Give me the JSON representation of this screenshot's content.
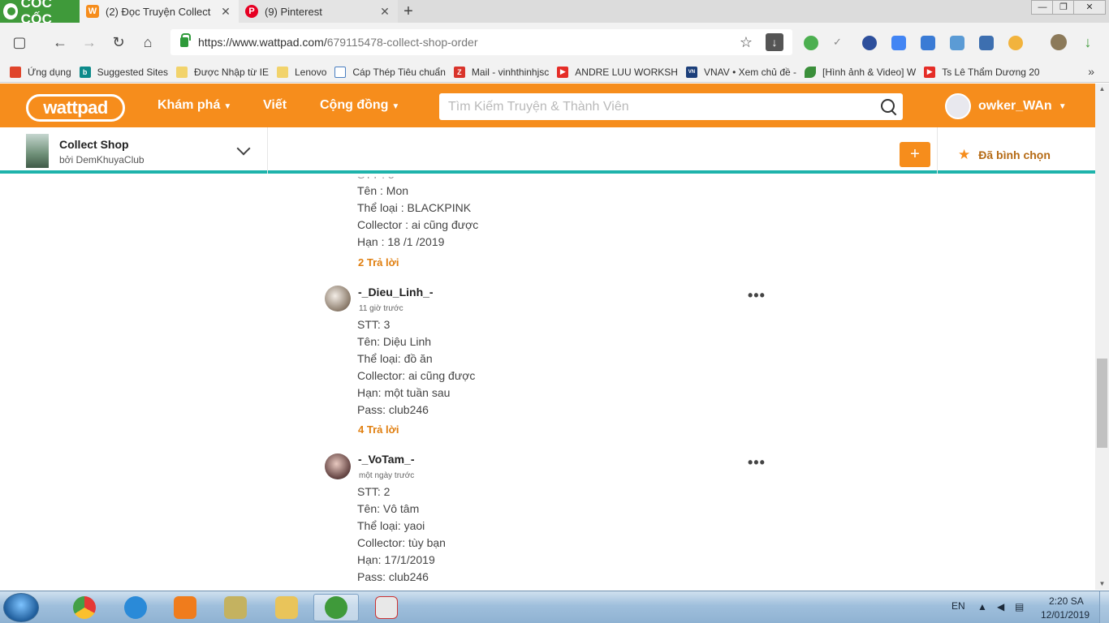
{
  "browser": {
    "logo": "CỐC CỐC",
    "tabs": [
      {
        "title": "(2) Đọc Truyện Collect",
        "close": "✕",
        "favicon": "wattpad-icon"
      },
      {
        "title": "(9) Pinterest",
        "close": "✕",
        "favicon": "pinterest-icon"
      }
    ],
    "new_tab": "+",
    "window_controls": [
      "—",
      "❐",
      "✕"
    ],
    "url_host": "https://www.wattpad.com/",
    "url_path": "679115478-collect-shop-order",
    "bookmarks": [
      {
        "label": "Ứng dụng",
        "icon": "apps-grid-icon",
        "color": "#e0452b"
      },
      {
        "label": "Suggested Sites",
        "icon": "bing-icon",
        "color": "#0d8a8a"
      },
      {
        "label": "Được Nhập từ IE",
        "icon": "folder-icon",
        "color": "#f2d36b"
      },
      {
        "label": "Lenovo",
        "icon": "folder-icon",
        "color": "#f2d36b"
      },
      {
        "label": "Cáp Thép Tiêu chuẩn",
        "icon": "page-icon",
        "color": "#4a7fc1"
      },
      {
        "label": "Mail - vinhthinhjsc",
        "icon": "zimbra-icon",
        "color": "#d9342b"
      },
      {
        "label": "ANDRE LUU WORKSH",
        "icon": "youtube-icon",
        "color": "#e52d27"
      },
      {
        "label": "VNAV • Xem chủ đề -",
        "icon": "vnav-icon",
        "color": "#1c3f7a"
      },
      {
        "label": "[Hình ảnh & Video] W",
        "icon": "leaf-icon",
        "color": "#3a8f3a"
      },
      {
        "label": "Ts Lê Thẩm Dương 20",
        "icon": "youtube-icon",
        "color": "#e52d27"
      }
    ],
    "bookmarks_more": "»"
  },
  "wattpad": {
    "logo": "wattpad",
    "nav": {
      "discover": "Khám phá",
      "write": "Viết",
      "community": "Cộng đồng"
    },
    "search_placeholder": "Tìm Kiếm Truyện & Thành Viên",
    "username": "owker_WAn",
    "brand_color": "#f68d1c",
    "accent_color": "#1eb3ab"
  },
  "story": {
    "title": "Collect Shop",
    "author": "bởi DemKhuyaClub",
    "add_label": "+",
    "voted_label": "Đã bình chọn"
  },
  "comments": [
    {
      "partial": true,
      "lines": [
        "Tên : Mon",
        "Thể loại :  BLACKPINK",
        "Collector : ai cũng được",
        "Hạn : 18 /1 /2019"
      ],
      "replies": "2 Trả lời"
    },
    {
      "user": "-_Dieu_Linh_-",
      "time": "11 giờ trước",
      "lines": [
        "STT: 3",
        "Tên: Diệu Linh",
        "Thể loại: đồ ăn",
        "Collector: ai cũng được",
        "Hạn: một tuần sau",
        "Pass: club246"
      ],
      "replies": "4 Trả lời",
      "more": "•••"
    },
    {
      "user": "-_VoTam_-",
      "time": "một ngày trước",
      "lines": [
        "STT: 2",
        "Tên: Vô tâm",
        "Thể loại: yaoi",
        "Collector: tùy bạn",
        "Hạn: 17/1/2019",
        "Pass: club246"
      ],
      "more": "•••"
    }
  ],
  "taskbar": {
    "language": "EN",
    "time": "2:20 SA",
    "date": "12/01/2019"
  }
}
